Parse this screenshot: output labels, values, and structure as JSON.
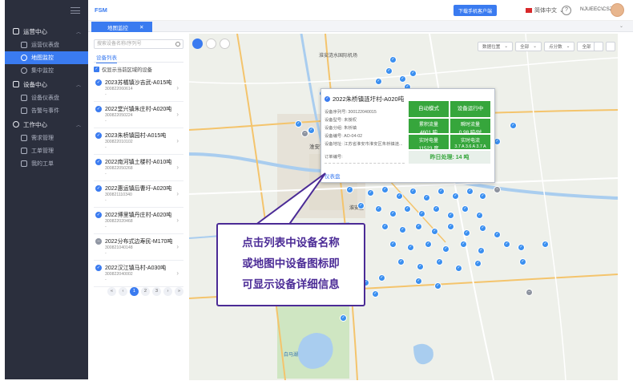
{
  "sidebar": {
    "groups": [
      {
        "label": "运营中心",
        "items": [
          {
            "label": "运营仪表盘"
          },
          {
            "label": "地图监控"
          },
          {
            "label": "集中监控"
          }
        ]
      },
      {
        "label": "设备中心",
        "items": [
          {
            "label": "设备仪表盘"
          },
          {
            "label": "告警与事件"
          }
        ]
      },
      {
        "label": "工作中心",
        "items": [
          {
            "label": "需求管理"
          },
          {
            "label": "工单管理"
          },
          {
            "label": "我的工单"
          }
        ]
      }
    ]
  },
  "header": {
    "brand": "FSM",
    "download_label": "下载手机客户端",
    "language": "简体中文",
    "help": "?",
    "user": "NJUEEC\\CSZH"
  },
  "tab": {
    "label": "地图监控",
    "close": "✕"
  },
  "panel": {
    "search_placeholder": "搜索设备名称/序列号",
    "list_tab": "设备列表",
    "only_area_label": "仅显示当前区域的设备",
    "devices": [
      {
        "name": "2023苏橘镇沙吉武-A015吨",
        "sn": "300822060614",
        "dash": "-"
      },
      {
        "name": "2022堂兴镇朱庄村-A020吨",
        "sn": "300822050224",
        "dash": "-"
      },
      {
        "name": "2023朱桥镇园村-A015吨",
        "sn": "300822010102",
        "dash": "-"
      },
      {
        "name": "2022南河镇土楼村-A010吨",
        "sn": "300822050268",
        "dash": "-"
      },
      {
        "name": "2022惠运镇后曹圩-A020吨",
        "sn": "300821110340",
        "dash": "-"
      },
      {
        "name": "2022博里镇丹庄村-A020吨",
        "sn": "300822020468",
        "dash": "-"
      },
      {
        "name": "2022分布式边寿民-M170吨",
        "sn": "300821040148",
        "dash": "-"
      },
      {
        "name": "2022汉江镇马村-A030吨",
        "sn": "300822040002",
        "dash": "-"
      }
    ],
    "pager": [
      "«",
      "‹",
      "1",
      "2",
      "3",
      "›",
      "»"
    ]
  },
  "map": {
    "filters": [
      "数据位置",
      "全部",
      "点分数",
      "全部"
    ],
    "popup": {
      "title": "2022朱桥镇涟圩村-A020吨",
      "lines": [
        "设备序列号: 300122040015",
        "设备型号: 未授权",
        "设备分组: 朱桥镇",
        "设备编号: AO-04-02",
        "设备地址: 江苏省淮安市淮安区朱桥镇涟..."
      ],
      "order_label": "订单编号:",
      "link": "仪表盘",
      "stats": {
        "mode": "自动模式",
        "running": "设备运行中",
        "flow_k": "累积流量",
        "flow_v": "4601 吨",
        "inst_k": "瞬时流量",
        "inst_v": "0.98 吨/时",
        "power_k": "实时电量",
        "power_v": "11523 度",
        "current_k": "实时电流",
        "current_v": "3.7 A  3.6 A  3.7 A",
        "yesterday": "昨日处理: 14 吨"
      }
    },
    "place_labels": [
      "淮安涟水国际机场",
      "淮安市",
      "淮安区",
      "白马湖"
    ]
  },
  "callout": {
    "lines": [
      "点击列表中设备名称",
      "或地图中设备图标即",
      "可显示设备详细信息"
    ]
  }
}
